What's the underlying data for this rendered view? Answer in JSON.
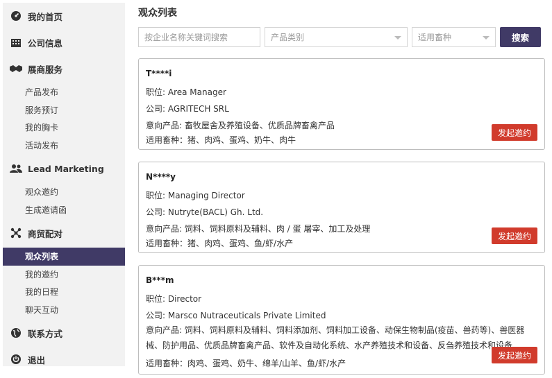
{
  "sidebar": {
    "groups": [
      {
        "label": "我的首页",
        "icon": "dashboard-icon"
      },
      {
        "label": "公司信息",
        "icon": "building-icon"
      },
      {
        "label": "展商服务",
        "icon": "handshake-icon",
        "items": [
          "产品发布",
          "服务预订",
          "我的胸卡",
          "活动发布"
        ]
      },
      {
        "label": "Lead Marketing",
        "icon": "users-icon",
        "items": [
          "观众邀约",
          "生成邀请函"
        ]
      },
      {
        "label": "商贸配对",
        "icon": "network-icon",
        "items": [
          "观众列表",
          "我的邀约",
          "我的日程",
          "聊天互动"
        ]
      },
      {
        "label": "联系方式",
        "icon": "globe-icon"
      },
      {
        "label": "退出",
        "icon": "power-icon"
      }
    ],
    "active_item": "观众列表"
  },
  "main": {
    "title": "观众列表",
    "search": {
      "placeholder": "按企业名称关键词搜索",
      "value": ""
    },
    "filter_category": "产品类别",
    "filter_species": "适用畜种",
    "search_button": "搜索"
  },
  "cards": [
    {
      "name": "T****i",
      "position": "职位: Area Manager",
      "company": "公司: AGRITECH SRL",
      "products": "意向产品: 畜牧屋舍及养殖设备、优质品牌畜禽产品",
      "species": "适用畜种：猪、肉鸡、蛋鸡、奶牛、肉牛",
      "button": "发起邀约"
    },
    {
      "name": "N****y",
      "position": "职位: Managing Director",
      "company": "公司: Nutryte(BACL) Gh. Ltd.",
      "products": "意向产品: 饲料、饲料原料及辅料、肉 / 蛋 屠宰、加工及处理",
      "species": "适用畜种：猪、肉鸡、蛋鸡、鱼/虾/水产",
      "button": "发起邀约"
    },
    {
      "name": "B***m",
      "position": "职位: Director",
      "company": "公司: Marsco Nutraceuticals Private Limited",
      "products": "意向产品: 饲料、饲料原料及辅料、饲料添加剂、饲料加工设备、动保生物制品(疫苗、兽药等)、兽医器械、防护用品、优质品牌畜禽产品、软件及自动化系统、水产养殖技术和设备、反刍养殖技术和设备",
      "species": "适用畜种：肉鸡、蛋鸡、奶牛、绵羊/山羊、鱼/虾/水产",
      "button": "发起邀约"
    }
  ]
}
